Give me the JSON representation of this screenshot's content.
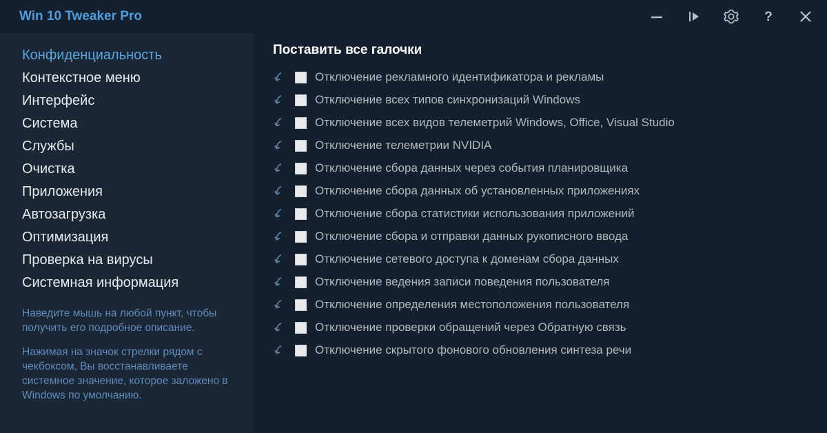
{
  "app": {
    "title": "Win 10 Tweaker Pro"
  },
  "sidebar": {
    "items": [
      "Конфиденциальность",
      "Контекстное меню",
      "Интерфейс",
      "Система",
      "Службы",
      "Очистка",
      "Приложения",
      "Автозагрузка",
      "Оптимизация",
      "Проверка на вирусы",
      "Системная информация"
    ],
    "active_index": 0,
    "hint1": "Наведите мышь на любой пункт, чтобы получить его подробное описание.",
    "hint2": "Нажимая на значок стрелки рядом с чекбоксом, Вы восстанавливаете системное значение, которое заложено в Windows по умолчанию."
  },
  "main": {
    "header": "Поставить все галочки",
    "rows": [
      "Отключение рекламного идентификатора и рекламы",
      "Отключение всех типов синхронизаций Windows",
      "Отключение всех видов телеметрий Windows, Office, Visual Studio",
      "Отключение телеметрии NVIDIA",
      "Отключение сбора данных через события планировщика",
      "Отключение сбора данных об установленных приложениях",
      "Отключение сбора статистики использования приложений",
      "Отключение сбора и отправки данных рукописного ввода",
      "Отключение сетевого доступа к доменам сбора данных",
      "Отключение ведения записи поведения пользователя",
      "Отключение определения местоположения пользователя",
      "Отключение проверки обращений через Обратную связь",
      "Отключение скрытого фонового обновления синтеза речи"
    ]
  }
}
